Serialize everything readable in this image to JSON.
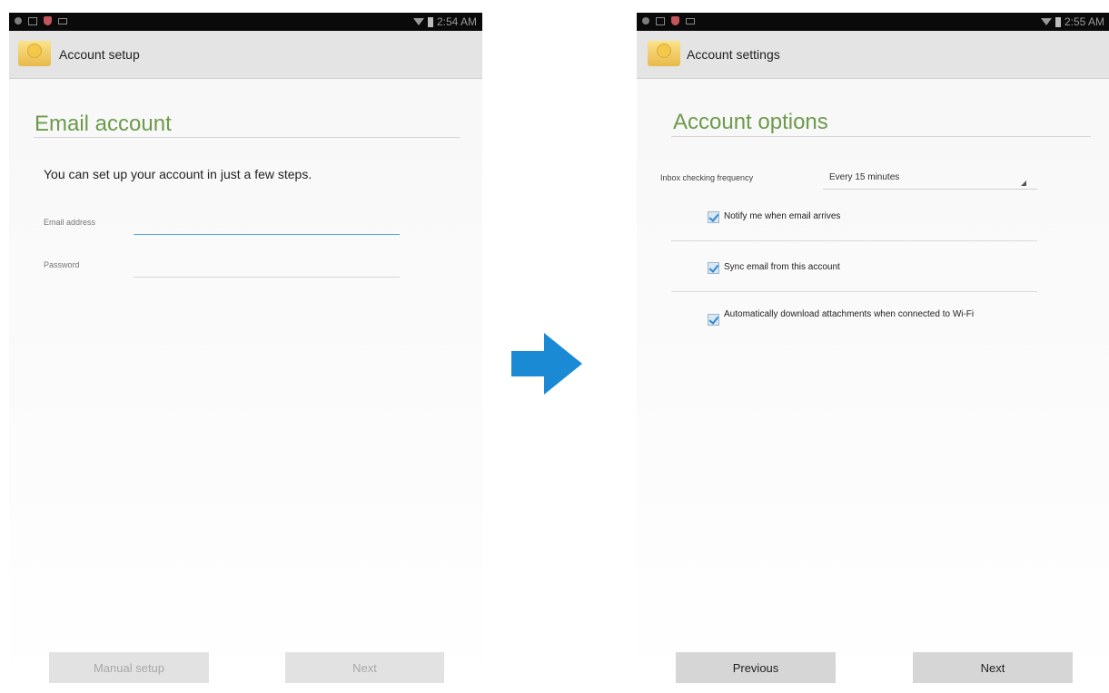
{
  "left": {
    "status_time": "2:54 AM",
    "app_title": "Account setup",
    "heading": "Email account",
    "intro": "You can set up your account in just a few steps.",
    "email_label": "Email address",
    "email_value": "",
    "password_label": "Password",
    "password_value": "",
    "manual_setup_label": "Manual setup",
    "next_label": "Next"
  },
  "right": {
    "status_time": "2:55 AM",
    "app_title": "Account settings",
    "heading": "Account options",
    "inbox_label": "Inbox checking frequency",
    "inbox_value": "Every 15 minutes",
    "options": [
      {
        "label": "Notify me when email arrives",
        "checked": true
      },
      {
        "label": "Sync email from this account",
        "checked": true
      },
      {
        "label": "Automatically download attachments when connected to Wi-Fi",
        "checked": true
      }
    ],
    "previous_label": "Previous",
    "next_label": "Next"
  },
  "colors": {
    "heading": "#6e9a4b",
    "arrow": "#1a8ad4",
    "active_underline": "#5aa8dc"
  }
}
